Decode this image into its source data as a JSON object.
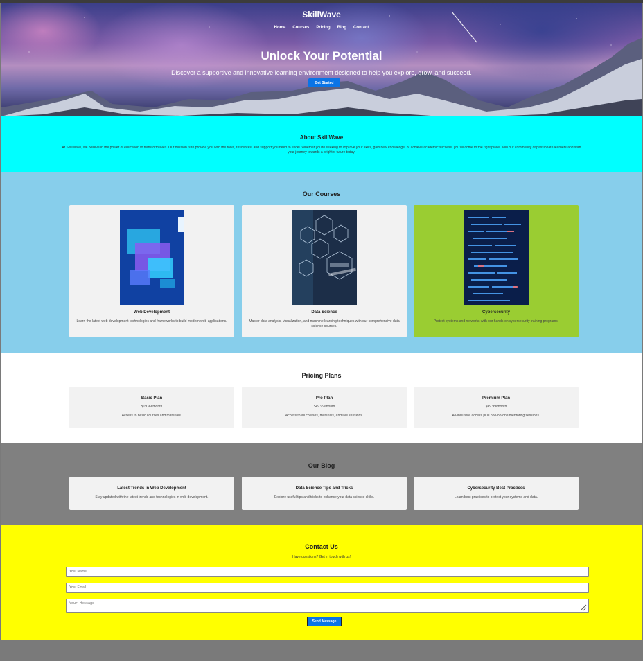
{
  "brand": "SkillWave",
  "nav": [
    "Home",
    "Courses",
    "Pricing",
    "Blog",
    "Contact"
  ],
  "hero": {
    "title": "Unlock Your Potential",
    "subtitle": "Discover a supportive and innovative learning environment designed to help you explore, grow, and succeed.",
    "cta": "Get Started"
  },
  "about": {
    "title": "About SkillWave",
    "text": "At SkillWave, we believe in the power of education to transform lives. Our mission is to provide you with the tools, resources, and support you need to excel. Whether you're seeking to improve your skills, gain new knowledge, or achieve academic success, you've come to the right place. Join our community of passionate learners and start your journey towards a brighter future today."
  },
  "courses": {
    "title": "Our Courses",
    "items": [
      {
        "name": "Web Development",
        "desc": "Learn the latest web development technologies and frameworks to build modern web applications."
      },
      {
        "name": "Data Science",
        "desc": "Master data analysis, visualization, and machine learning techniques with our comprehensive data science courses."
      },
      {
        "name": "Cybersecurity",
        "desc": "Protect systems and networks with our hands-on cybersecurity training programs."
      }
    ]
  },
  "pricing": {
    "title": "Pricing Plans",
    "plans": [
      {
        "name": "Basic Plan",
        "price": "$19.99/month",
        "desc": "Access to basic courses and materials."
      },
      {
        "name": "Pro Plan",
        "price": "$49.99/month",
        "desc": "Access to all courses, materials, and live sessions."
      },
      {
        "name": "Premium Plan",
        "price": "$99.99/month",
        "desc": "All-inclusive access plus one-on-one mentoring sessions."
      }
    ]
  },
  "blog": {
    "title": "Our Blog",
    "posts": [
      {
        "title": "Latest Trends in Web Development",
        "desc": "Stay updated with the latest trends and technologies in web development."
      },
      {
        "title": "Data Science Tips and Tricks",
        "desc": "Explore useful tips and tricks to enhance your data science skills."
      },
      {
        "title": "Cybersecurity Best Practices",
        "desc": "Learn best practices to protect your systems and data."
      }
    ]
  },
  "contact": {
    "title": "Contact Us",
    "lead": "Have questions? Get in touch with us!",
    "name_placeholder": "Your Name",
    "email_placeholder": "Your Email",
    "message_placeholder": "Your Message",
    "send_label": "Send Message"
  },
  "colors": {
    "about_bg": "#00ffff",
    "courses_bg": "#87ceeb",
    "highlight_card": "#9acd32",
    "blog_bg": "#808080",
    "contact_bg": "#ffff00",
    "button": "#0a74e6"
  }
}
